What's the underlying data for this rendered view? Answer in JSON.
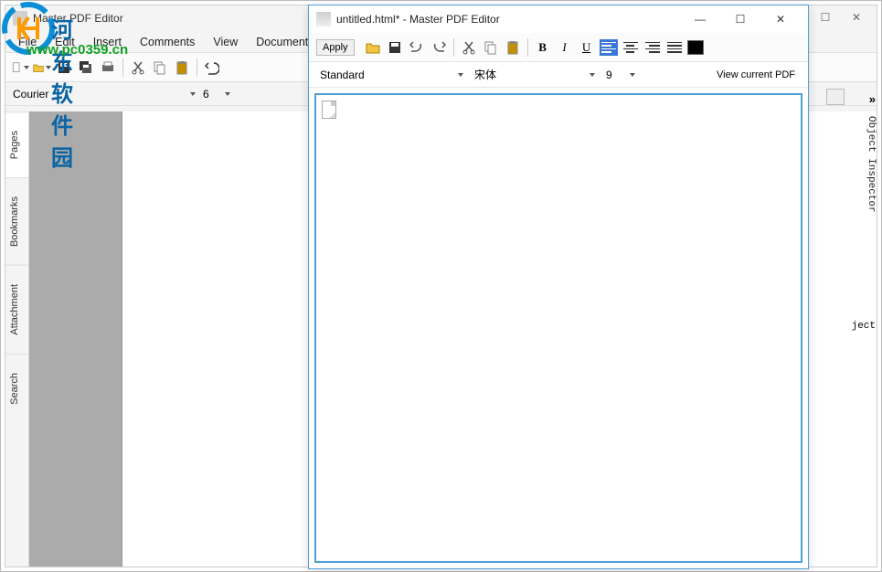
{
  "watermark": {
    "text1": "河东软件园",
    "text2": "www.pc0359.cn"
  },
  "back": {
    "title": "Master PDF Editor",
    "menu": [
      "File",
      "Edit",
      "Insert",
      "Comments",
      "View",
      "Document"
    ],
    "font_name": "Courier",
    "font_size": "6",
    "side_tabs": [
      "Pages",
      "Bookmarks",
      "Attachment",
      "Search"
    ]
  },
  "right": {
    "inspector": "Object Inspector",
    "ject": "ject",
    "chev": "»"
  },
  "front": {
    "title": "untitled.html* - Master PDF Editor",
    "apply": "Apply",
    "style_name": "Standard",
    "font_family": "宋体",
    "font_size": "9",
    "view_pdf": "View current PDF",
    "win_min": "—",
    "win_max": "☐",
    "win_close": "✕"
  }
}
